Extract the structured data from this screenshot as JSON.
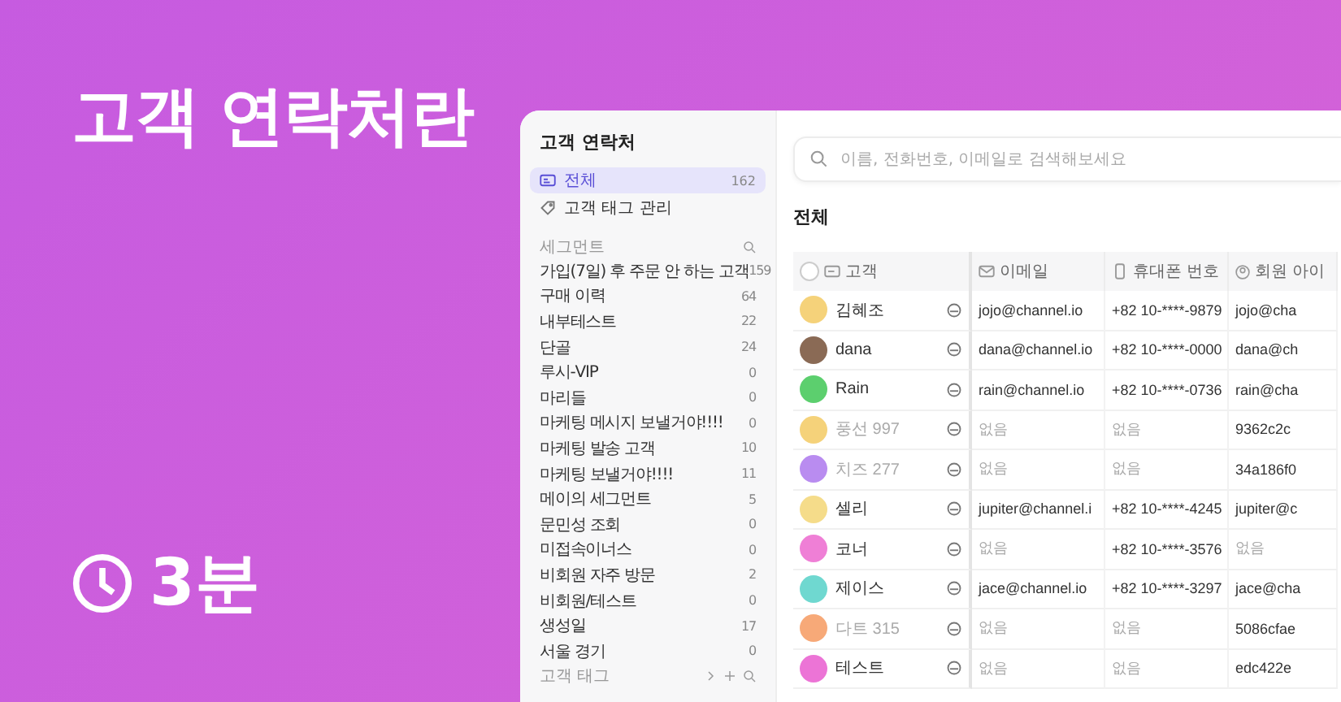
{
  "hero": {
    "title": "고객 연락처란",
    "duration": "3분"
  },
  "sidebar": {
    "title": "고객 연락처",
    "nav": [
      {
        "kind": "all",
        "label": "전체",
        "count": "162",
        "selected": true
      },
      {
        "kind": "tag",
        "label": "고객 태그 관리",
        "selected": false
      }
    ],
    "segments_header": "세그먼트",
    "segments": [
      {
        "label": "가입(7일) 후 주문 안 하는 고객",
        "count": "159"
      },
      {
        "label": "구매 이력",
        "count": "64"
      },
      {
        "label": "내부테스트",
        "count": "22"
      },
      {
        "label": "단골",
        "count": "24"
      },
      {
        "label": "루시-VIP",
        "count": "0"
      },
      {
        "label": "마리들",
        "count": "0"
      },
      {
        "label": "마케팅 메시지 보낼거야!!!!",
        "count": "0"
      },
      {
        "label": "마케팅 발송 고객",
        "count": "10"
      },
      {
        "label": "마케팅 보낼거야!!!!",
        "count": "11"
      },
      {
        "label": "메이의 세그먼트",
        "count": "5"
      },
      {
        "label": "문민성 조회",
        "count": "0"
      },
      {
        "label": "미접속이너스",
        "count": "0"
      },
      {
        "label": "비회원 자주 방문",
        "count": "2"
      },
      {
        "label": "비회원/테스트",
        "count": "0"
      },
      {
        "label": "생성일",
        "count": "17"
      },
      {
        "label": "서울 경기",
        "count": "0"
      }
    ],
    "tags_header": "고객 태그"
  },
  "search": {
    "placeholder": "이름, 전화번호, 이메일로 검색해보세요"
  },
  "list_title": "전체",
  "table": {
    "select_all_checked": false,
    "columns": [
      "고객",
      "이메일",
      "휴대폰 번호",
      "회원 아이"
    ],
    "rows": [
      {
        "color": "#f5d27a",
        "cells": [
          {
            "text": "김혜조",
            "dimmed": false
          },
          {
            "text": "jojo@channel.io",
            "dimmed": false
          },
          {
            "text": "+82 10-****-9879",
            "dimmed": false
          },
          {
            "text": "jojo@cha",
            "dimmed": false
          }
        ]
      },
      {
        "color": "#8a6a55",
        "cells": [
          {
            "text": "dana",
            "dimmed": false
          },
          {
            "text": "dana@channel.io",
            "dimmed": false
          },
          {
            "text": "+82 10-****-0000",
            "dimmed": false
          },
          {
            "text": "dana@ch",
            "dimmed": false
          }
        ]
      },
      {
        "color": "#5ccf6e",
        "cells": [
          {
            "text": "Rain",
            "dimmed": false
          },
          {
            "text": "rain@channel.io",
            "dimmed": false
          },
          {
            "text": "+82 10-****-0736",
            "dimmed": false
          },
          {
            "text": "rain@cha",
            "dimmed": false
          }
        ]
      },
      {
        "color": "#f5d27a",
        "cells": [
          {
            "text": "풍선 997",
            "dimmed": true
          },
          {
            "text": "없음",
            "dimmed": true
          },
          {
            "text": "없음",
            "dimmed": true
          },
          {
            "text": "9362c2c",
            "dimmed": false
          }
        ]
      },
      {
        "color": "#b98cf0",
        "cells": [
          {
            "text": "치즈 277",
            "dimmed": true
          },
          {
            "text": "없음",
            "dimmed": true
          },
          {
            "text": "없음",
            "dimmed": true
          },
          {
            "text": "34a186f0",
            "dimmed": false
          }
        ]
      },
      {
        "color": "#f5dc8a",
        "cells": [
          {
            "text": "셀리",
            "dimmed": false
          },
          {
            "text": "jupiter@channel.i",
            "dimmed": false
          },
          {
            "text": "+82 10-****-4245",
            "dimmed": false
          },
          {
            "text": "jupiter@c",
            "dimmed": false
          }
        ]
      },
      {
        "color": "#ef7fd6",
        "cells": [
          {
            "text": "코너",
            "dimmed": false
          },
          {
            "text": "없음",
            "dimmed": true
          },
          {
            "text": "+82 10-****-3576",
            "dimmed": false
          },
          {
            "text": "없음",
            "dimmed": true
          }
        ]
      },
      {
        "color": "#6fd8d0",
        "cells": [
          {
            "text": "제이스",
            "dimmed": false
          },
          {
            "text": "jace@channel.io",
            "dimmed": false
          },
          {
            "text": "+82 10-****-3297",
            "dimmed": false
          },
          {
            "text": "jace@cha",
            "dimmed": false
          }
        ]
      },
      {
        "color": "#f7a978",
        "cells": [
          {
            "text": "다트 315",
            "dimmed": true
          },
          {
            "text": "없음",
            "dimmed": true
          },
          {
            "text": "없음",
            "dimmed": true
          },
          {
            "text": "5086cfae",
            "dimmed": false
          }
        ]
      },
      {
        "color": "#ec74d6",
        "cells": [
          {
            "text": "테스트",
            "dimmed": false
          },
          {
            "text": "없음",
            "dimmed": true
          },
          {
            "text": "없음",
            "dimmed": true
          },
          {
            "text": "edc422e",
            "dimmed": false
          }
        ]
      }
    ]
  }
}
